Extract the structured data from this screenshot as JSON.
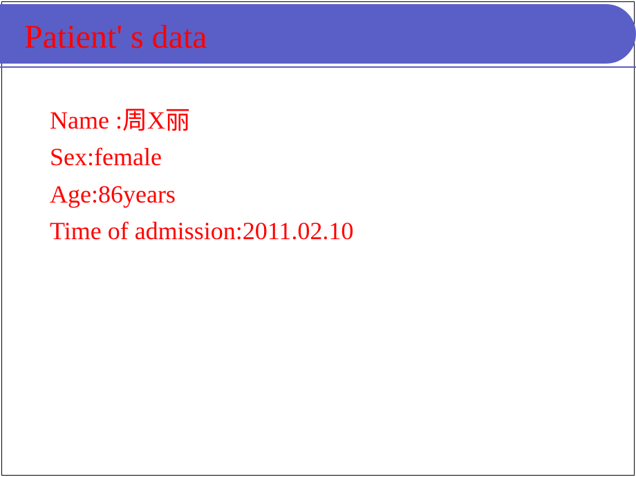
{
  "slide": {
    "title": "Patient' s data",
    "fields": {
      "name_label": "Name :",
      "name_value": "周X丽",
      "sex_label": "Sex:",
      "sex_value": "female",
      "age_label": "Age:",
      "age_value": "86years",
      "admission_label": "Time of admission:",
      "admission_value": "2011.02.10"
    }
  }
}
